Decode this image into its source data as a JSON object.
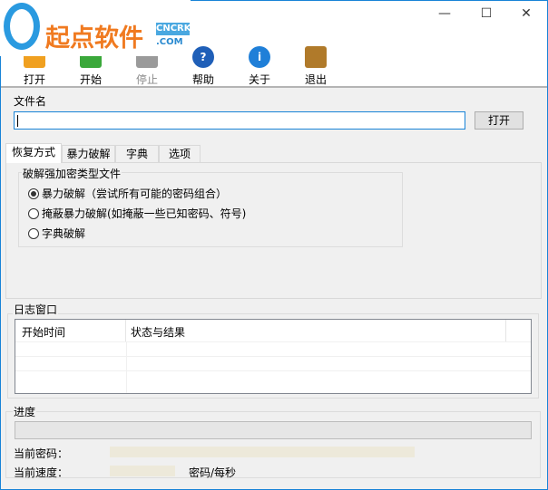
{
  "window": {
    "minimize": "—",
    "maximize": "☐",
    "close": "✕"
  },
  "logo": {
    "text": "起点软件",
    "badge_top": "CNCRK",
    "badge_bottom": ".COM"
  },
  "toolbar": [
    {
      "label": "打开",
      "icon": "open-folder-icon",
      "color": "#f0a020"
    },
    {
      "label": "开始",
      "icon": "play-icon",
      "color": "#3aa83a"
    },
    {
      "label": "停止",
      "icon": "stop-icon",
      "color": "#9a9a9a",
      "disabled": true
    },
    {
      "label": "帮助",
      "icon": "help-icon",
      "color": "#1f5fb8"
    },
    {
      "label": "关于",
      "icon": "info-icon",
      "color": "#1f7fd8"
    },
    {
      "label": "退出",
      "icon": "exit-door-icon",
      "color": "#b07a2a"
    }
  ],
  "file": {
    "label": "文件名",
    "value": "",
    "open_button": "打开"
  },
  "tabs": [
    "恢复方式",
    "暴力破解",
    "字典",
    "选项"
  ],
  "recovery": {
    "group_label": "破解强加密类型文件",
    "options": [
      "暴力破解（尝试所有可能的密码组合）",
      "掩蔽暴力破解(如掩蔽一些已知密码、符号)",
      "字典破解"
    ],
    "selected": 0
  },
  "log": {
    "label": "日志窗口",
    "columns": [
      "开始时间",
      "状态与结果"
    ]
  },
  "progress": {
    "label": "进度",
    "value": 0,
    "current_password_label": "当前密码：",
    "current_password": "",
    "current_speed_label": "当前速度：",
    "current_speed": "",
    "speed_unit": "密码/每秒"
  }
}
